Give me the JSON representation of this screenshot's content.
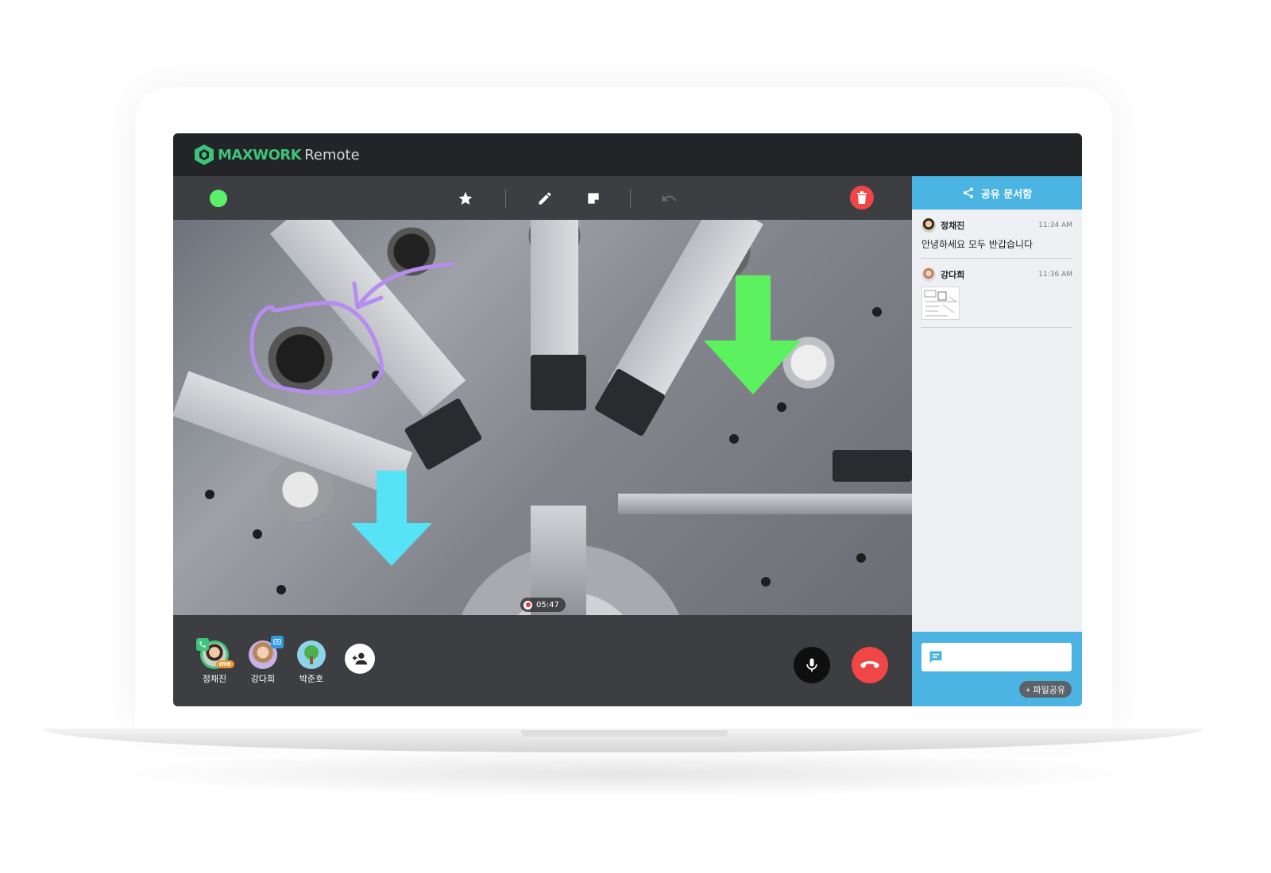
{
  "app": {
    "brand": "MAXWORK",
    "product": "Remote"
  },
  "colors": {
    "brand_green": "#3ec47a",
    "status_green": "#5cf06a",
    "danger_red": "#f04646",
    "side_accent": "#4bb4e2",
    "draw_purple": "#b78cf0",
    "arrow_green": "#5cf25f",
    "arrow_cyan": "#55e3f5"
  },
  "toolbar": {
    "status_icon": "status-dot",
    "tools": [
      "star-icon",
      "pencil-icon",
      "sticky-note-icon",
      "undo-icon"
    ],
    "delete_icon": "trash-icon"
  },
  "video": {
    "recording_time": "05:47"
  },
  "participants": [
    {
      "name": "정채진",
      "badge": "me",
      "status_icon": "phone-icon"
    },
    {
      "name": "강다희",
      "status_icon": "screen-share-icon"
    },
    {
      "name": "박준호"
    }
  ],
  "controls": {
    "add_user_icon": "add-user-icon",
    "mic_icon": "microphone-icon",
    "hangup_icon": "hang-up-icon"
  },
  "side_panel": {
    "title": "공유 문서함",
    "messages": [
      {
        "name": "정채진",
        "time": "11:34 AM",
        "text": "안녕하세요 모두 반갑습니다"
      },
      {
        "name": "강다희",
        "time": "11:36 AM",
        "attachment": "document-thumbnail"
      }
    ],
    "chat_placeholder": "",
    "file_share_label": "+ 파일공유"
  }
}
